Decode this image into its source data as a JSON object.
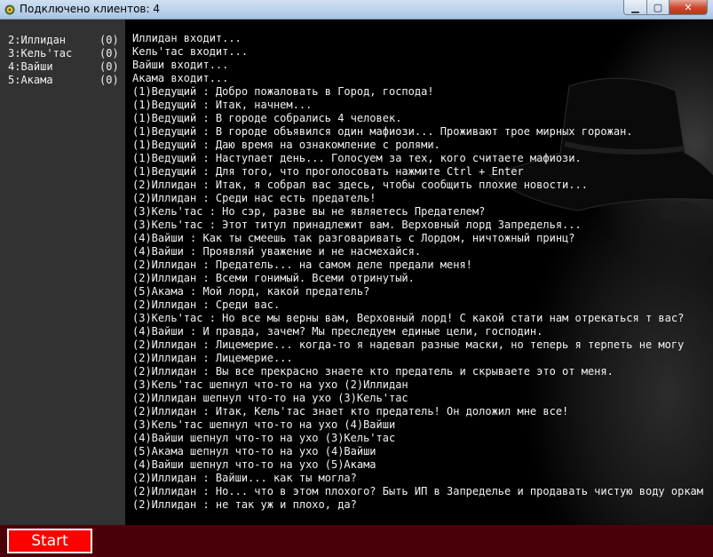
{
  "window": {
    "title": "Подключено клиентов: 4",
    "icons": {
      "app": "gear-icon",
      "minimize": "minimize-icon",
      "maximize": "maximize-icon",
      "close": "close-icon"
    }
  },
  "players": [
    {
      "name": "2:Иллидан",
      "score": "(0)"
    },
    {
      "name": "3:Кель'тас",
      "score": "(0)"
    },
    {
      "name": "4:Вайши",
      "score": "(0)"
    },
    {
      "name": "5:Акама",
      "score": "(0)"
    }
  ],
  "chat": {
    "lines": [
      "Иллидан входит...",
      "Кель'тас входит...",
      "Вайши входит...",
      "Акама входит...",
      "(1)Ведущий : Добро пожаловать в Город, господа!",
      "(1)Ведущий : Итак, начнем...",
      "(1)Ведущий : В городе собрались 4 человек.",
      "(1)Ведущий : В городе объявился один мафиози... Проживают трое мирных горожан.",
      "(1)Ведущий : Даю время на ознакомление с ролями.",
      "(1)Ведущий : Наступает день... Голосуем за тех, кого считаете мафиози.",
      "(1)Ведущий : Для того, что проголосовать нажмите Ctrl + Enter",
      "(2)Иллидан : Итак, я собрал вас здесь, чтобы сообщить плохие новости...",
      "(2)Иллидан : Среди нас есть предатель!",
      "(3)Кель'тас : Но сэр, разве вы не являетесь Предателем?",
      "(3)Кель'тас : Этот титул принадлежит вам. Верховный лорд Запределья...",
      "(4)Вайши : Как ты смеешь так разговаривать с Лордом, ничтожный принц?",
      "(4)Вайши : Проявляй уважение и не насмехайся.",
      "(2)Иллидан : Предатель... на самом деле предали меня!",
      "(2)Иллидан : Всеми гонимый. Всеми отринутый.",
      "(5)Акама : Мой лорд, какой предатель?",
      "(2)Иллидан : Среди вас.",
      "(3)Кель'тас : Но все мы верны вам, Верховный лорд! С какой стати нам отрекаться т вас?",
      "(4)Вайши : И правда, зачем? Мы преследуем единые цели, господин.",
      "(2)Иллидан : Лицемерие... когда-то я надевал разные маски, но теперь я терпеть не могу",
      "(2)Иллидан : Лицемерие...",
      "(2)Иллидан : Вы все прекрасно знаете кто предатель и скрываете это от меня.",
      "(3)Кель'тас шепнул что-то на ухо (2)Иллидан",
      "(2)Иллидан шепнул что-то на ухо (3)Кель'тас",
      "(2)Иллидан : Итак, Кель'тас знает кто предатель! Он доложил мне все!",
      "(3)Кель'тас шепнул что-то на ухо (4)Вайши",
      "(4)Вайши шепнул что-то на ухо (3)Кель'тас",
      "(5)Акама шепнул что-то на ухо (4)Вайши",
      "(4)Вайши шепнул что-то на ухо (5)Акама",
      "(2)Иллидан : Вайши... как ты могла?",
      "(2)Иллидан : Но... что в этом плохого? Быть ИП в Запределье и продавать чистую воду оркам",
      "(2)Иллидан : не так уж и плохо, да?"
    ]
  },
  "bottom": {
    "start_label": "Start"
  },
  "colors": {
    "bottom_bar": "#4a0008",
    "start_button": "#ff0000",
    "player_panel": "#323232"
  }
}
